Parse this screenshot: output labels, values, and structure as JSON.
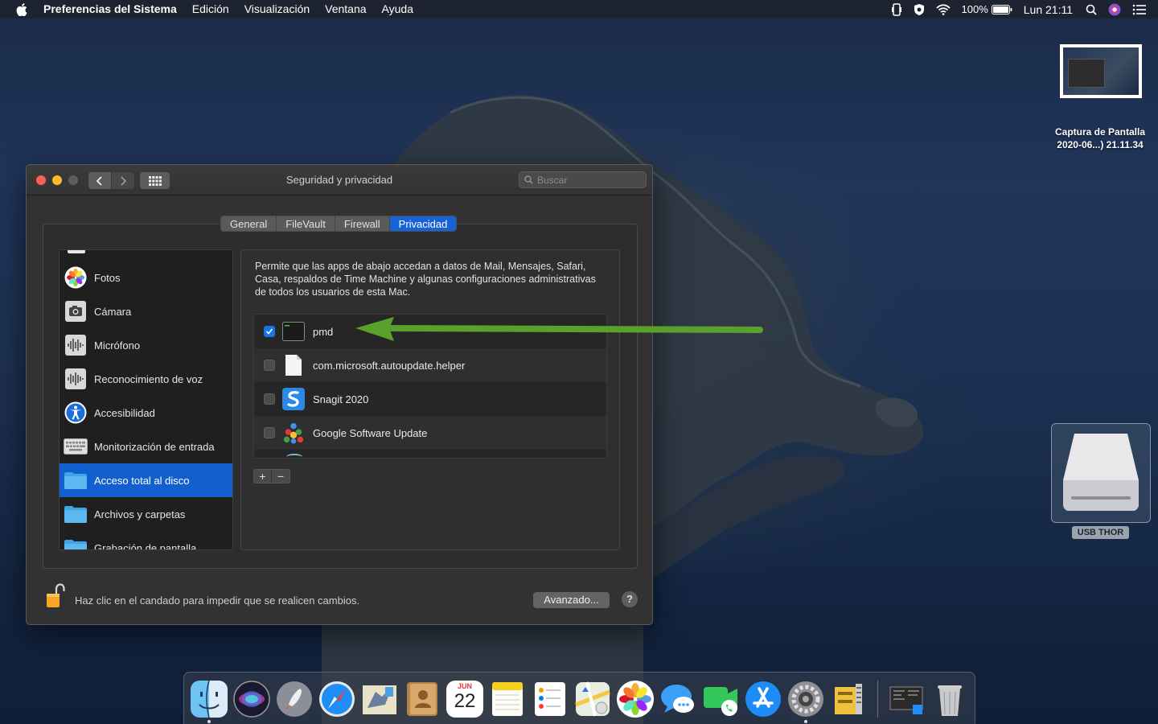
{
  "menubar": {
    "app_name": "Preferencias del Sistema",
    "items": [
      "Edición",
      "Visualización",
      "Ventana",
      "Ayuda"
    ],
    "battery": "100%",
    "clock": "Lun 21:11"
  },
  "desktop": {
    "screenshot_label_line1": "Captura de Pantalla",
    "screenshot_label_line2": "2020-06...) 21.11.34",
    "drive_label": "USB THOR"
  },
  "window": {
    "title": "Seguridad y privacidad",
    "search_placeholder": "Buscar",
    "tabs": [
      "General",
      "FileVault",
      "Firewall",
      "Privacidad"
    ],
    "active_tab": "Privacidad",
    "sidebar": [
      {
        "label": "Fotos",
        "icon": "photos-icon"
      },
      {
        "label": "Cámara",
        "icon": "camera-icon"
      },
      {
        "label": "Micrófono",
        "icon": "microphone-icon"
      },
      {
        "label": "Reconocimiento de voz",
        "icon": "speech-recognition-icon"
      },
      {
        "label": "Accesibilidad",
        "icon": "accessibility-icon"
      },
      {
        "label": "Monitorización de entrada",
        "icon": "keyboard-icon"
      },
      {
        "label": "Acceso total al disco",
        "icon": "folder-icon",
        "selected": true
      },
      {
        "label": "Archivos y carpetas",
        "icon": "folder-icon"
      },
      {
        "label": "Grabación de pantalla",
        "icon": "folder-icon"
      }
    ],
    "description": "Permite que las apps de abajo accedan a datos de Mail, Mensajes, Safari, Casa, respaldos de Time Machine y algunas configuraciones administrativas de todos los usuarios de esta Mac.",
    "apps": [
      {
        "name": "pmd",
        "checked": true,
        "icon": "terminal-icon"
      },
      {
        "name": "com.microsoft.autoupdate.helper",
        "checked": false,
        "icon": "document-icon"
      },
      {
        "name": "Snagit 2020",
        "checked": false,
        "icon": "snagit-icon"
      },
      {
        "name": "Google Software Update",
        "checked": false,
        "icon": "google-update-icon"
      }
    ],
    "add_label": "+",
    "remove_label": "−",
    "lock_text": "Haz clic en el candado para impedir que se realicen cambios.",
    "advanced_button": "Avanzado...",
    "help_button": "?"
  },
  "dock": {
    "apps": [
      "finder-icon",
      "siri-icon",
      "launchpad-icon",
      "safari-icon",
      "mail-icon",
      "contacts-icon",
      "calendar-icon",
      "notes-icon",
      "reminders-icon",
      "maps-icon",
      "photos-icon",
      "messages-icon",
      "facetime-icon",
      "app-store-icon",
      "system-preferences-icon",
      "archive-utility-icon",
      "screenshot-icon",
      "trash-icon"
    ],
    "calendar_month": "JUN",
    "calendar_day": "22"
  },
  "colors": {
    "accent": "#1862d8",
    "arrow": "#5aa02c"
  }
}
